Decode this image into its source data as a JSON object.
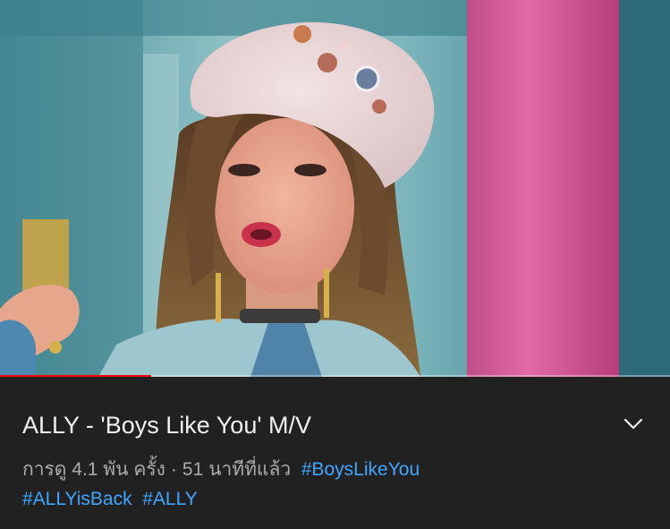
{
  "video": {
    "thumbnail_alt": "ALLY music video frame",
    "progress": 0.225
  },
  "info": {
    "title": "ALLY - 'Boys Like You' M/V",
    "views": "การดู 4.1 พัน ครั้ง",
    "separator": "·",
    "age": "51 นาทีที่แล้ว",
    "hashtags": [
      "#BoysLikeYou",
      "#ALLYisBack",
      "#ALLY"
    ],
    "expand_icon": "chevron-down-icon"
  },
  "colors": {
    "background": "#212121",
    "title": "#f1f1f1",
    "meta": "#aaaaaa",
    "hashtag": "#3ea6ff",
    "progress": "#ff0000"
  }
}
